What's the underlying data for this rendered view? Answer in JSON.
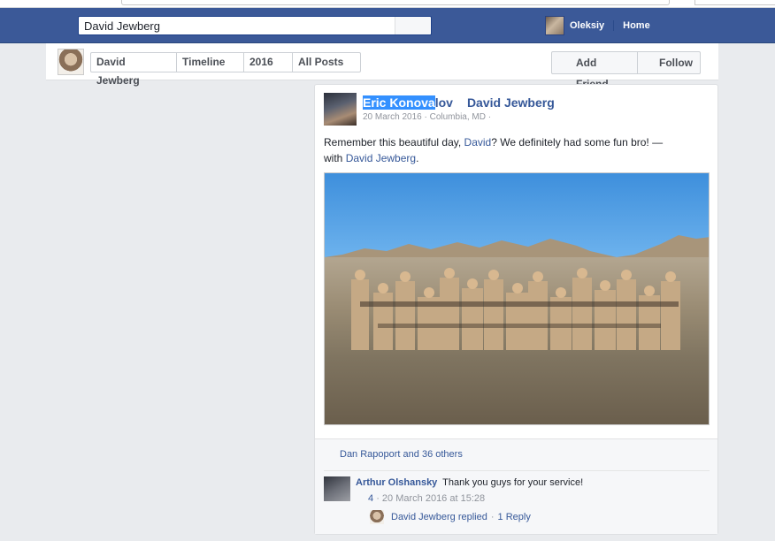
{
  "search": {
    "value": "David Jewberg"
  },
  "user": {
    "name": "Oleksiy"
  },
  "nav": {
    "home_label": "Home"
  },
  "timeline_bar": {
    "crumbs": [
      "David Jewberg",
      "Timeline",
      "2016",
      "All Posts"
    ],
    "add_friend_label": "Add Friend",
    "follow_label": "Follow"
  },
  "post": {
    "author_selected": "Eric Konova",
    "author_rest": "lov",
    "tagged": "David Jewberg",
    "date": "20 March 2016",
    "location": "Columbia, MD",
    "text_before": "Remember this beautiful day, ",
    "text_link": "David",
    "text_after": "? We definitely had some fun bro! —",
    "with_prefix": "with ",
    "with_link": "David Jewberg",
    "with_suffix": ".",
    "likes": "Dan Rapoport and 36 others"
  },
  "comment": {
    "author": "Arthur Olshansky",
    "text": "Thank you guys for your service!",
    "likes_count": "4",
    "timestamp": "20 March 2016 at 15:28",
    "reply_author_text": "David Jewberg replied",
    "reply_count_text": "1 Reply"
  },
  "colors": {
    "bluebar": "#3b5998",
    "link": "#365899",
    "selection": "#3390ff"
  }
}
